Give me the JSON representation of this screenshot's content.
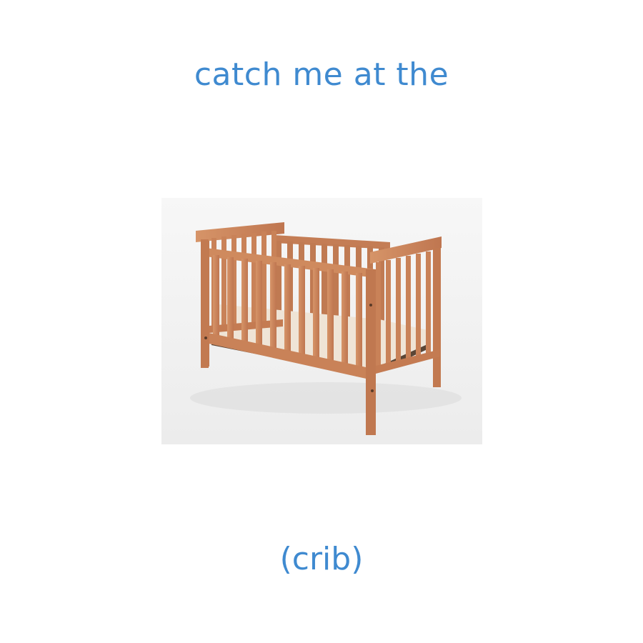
{
  "headline": "catch me at the",
  "caption": "(crib)",
  "image": {
    "subject": "wooden-crib",
    "alt": "wooden baby crib"
  },
  "colors": {
    "text": "#3f8ad0",
    "background": "#ffffff",
    "wood": "#c9835a",
    "photo_backdrop": "#f3f3f3"
  }
}
